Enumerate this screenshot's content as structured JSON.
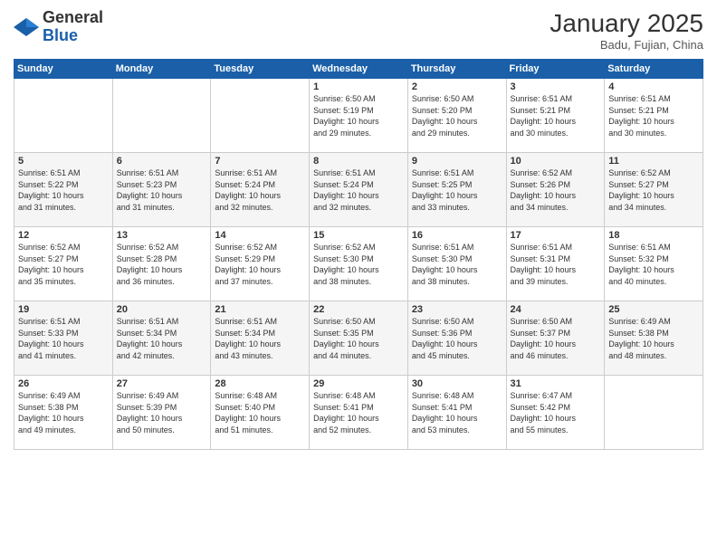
{
  "header": {
    "logo": {
      "general": "General",
      "blue": "Blue"
    },
    "month": "January 2025",
    "location": "Badu, Fujian, China"
  },
  "days_header": [
    "Sunday",
    "Monday",
    "Tuesday",
    "Wednesday",
    "Thursday",
    "Friday",
    "Saturday"
  ],
  "weeks": [
    {
      "cells": [
        {
          "day": null,
          "info": null
        },
        {
          "day": null,
          "info": null
        },
        {
          "day": null,
          "info": null
        },
        {
          "day": "1",
          "info": "Sunrise: 6:50 AM\nSunset: 5:19 PM\nDaylight: 10 hours\nand 29 minutes."
        },
        {
          "day": "2",
          "info": "Sunrise: 6:50 AM\nSunset: 5:20 PM\nDaylight: 10 hours\nand 29 minutes."
        },
        {
          "day": "3",
          "info": "Sunrise: 6:51 AM\nSunset: 5:21 PM\nDaylight: 10 hours\nand 30 minutes."
        },
        {
          "day": "4",
          "info": "Sunrise: 6:51 AM\nSunset: 5:21 PM\nDaylight: 10 hours\nand 30 minutes."
        }
      ]
    },
    {
      "cells": [
        {
          "day": "5",
          "info": "Sunrise: 6:51 AM\nSunset: 5:22 PM\nDaylight: 10 hours\nand 31 minutes."
        },
        {
          "day": "6",
          "info": "Sunrise: 6:51 AM\nSunset: 5:23 PM\nDaylight: 10 hours\nand 31 minutes."
        },
        {
          "day": "7",
          "info": "Sunrise: 6:51 AM\nSunset: 5:24 PM\nDaylight: 10 hours\nand 32 minutes."
        },
        {
          "day": "8",
          "info": "Sunrise: 6:51 AM\nSunset: 5:24 PM\nDaylight: 10 hours\nand 32 minutes."
        },
        {
          "day": "9",
          "info": "Sunrise: 6:51 AM\nSunset: 5:25 PM\nDaylight: 10 hours\nand 33 minutes."
        },
        {
          "day": "10",
          "info": "Sunrise: 6:52 AM\nSunset: 5:26 PM\nDaylight: 10 hours\nand 34 minutes."
        },
        {
          "day": "11",
          "info": "Sunrise: 6:52 AM\nSunset: 5:27 PM\nDaylight: 10 hours\nand 34 minutes."
        }
      ]
    },
    {
      "cells": [
        {
          "day": "12",
          "info": "Sunrise: 6:52 AM\nSunset: 5:27 PM\nDaylight: 10 hours\nand 35 minutes."
        },
        {
          "day": "13",
          "info": "Sunrise: 6:52 AM\nSunset: 5:28 PM\nDaylight: 10 hours\nand 36 minutes."
        },
        {
          "day": "14",
          "info": "Sunrise: 6:52 AM\nSunset: 5:29 PM\nDaylight: 10 hours\nand 37 minutes."
        },
        {
          "day": "15",
          "info": "Sunrise: 6:52 AM\nSunset: 5:30 PM\nDaylight: 10 hours\nand 38 minutes."
        },
        {
          "day": "16",
          "info": "Sunrise: 6:51 AM\nSunset: 5:30 PM\nDaylight: 10 hours\nand 38 minutes."
        },
        {
          "day": "17",
          "info": "Sunrise: 6:51 AM\nSunset: 5:31 PM\nDaylight: 10 hours\nand 39 minutes."
        },
        {
          "day": "18",
          "info": "Sunrise: 6:51 AM\nSunset: 5:32 PM\nDaylight: 10 hours\nand 40 minutes."
        }
      ]
    },
    {
      "cells": [
        {
          "day": "19",
          "info": "Sunrise: 6:51 AM\nSunset: 5:33 PM\nDaylight: 10 hours\nand 41 minutes."
        },
        {
          "day": "20",
          "info": "Sunrise: 6:51 AM\nSunset: 5:34 PM\nDaylight: 10 hours\nand 42 minutes."
        },
        {
          "day": "21",
          "info": "Sunrise: 6:51 AM\nSunset: 5:34 PM\nDaylight: 10 hours\nand 43 minutes."
        },
        {
          "day": "22",
          "info": "Sunrise: 6:50 AM\nSunset: 5:35 PM\nDaylight: 10 hours\nand 44 minutes."
        },
        {
          "day": "23",
          "info": "Sunrise: 6:50 AM\nSunset: 5:36 PM\nDaylight: 10 hours\nand 45 minutes."
        },
        {
          "day": "24",
          "info": "Sunrise: 6:50 AM\nSunset: 5:37 PM\nDaylight: 10 hours\nand 46 minutes."
        },
        {
          "day": "25",
          "info": "Sunrise: 6:49 AM\nSunset: 5:38 PM\nDaylight: 10 hours\nand 48 minutes."
        }
      ]
    },
    {
      "cells": [
        {
          "day": "26",
          "info": "Sunrise: 6:49 AM\nSunset: 5:38 PM\nDaylight: 10 hours\nand 49 minutes."
        },
        {
          "day": "27",
          "info": "Sunrise: 6:49 AM\nSunset: 5:39 PM\nDaylight: 10 hours\nand 50 minutes."
        },
        {
          "day": "28",
          "info": "Sunrise: 6:48 AM\nSunset: 5:40 PM\nDaylight: 10 hours\nand 51 minutes."
        },
        {
          "day": "29",
          "info": "Sunrise: 6:48 AM\nSunset: 5:41 PM\nDaylight: 10 hours\nand 52 minutes."
        },
        {
          "day": "30",
          "info": "Sunrise: 6:48 AM\nSunset: 5:41 PM\nDaylight: 10 hours\nand 53 minutes."
        },
        {
          "day": "31",
          "info": "Sunrise: 6:47 AM\nSunset: 5:42 PM\nDaylight: 10 hours\nand 55 minutes."
        },
        {
          "day": null,
          "info": null
        }
      ]
    }
  ]
}
